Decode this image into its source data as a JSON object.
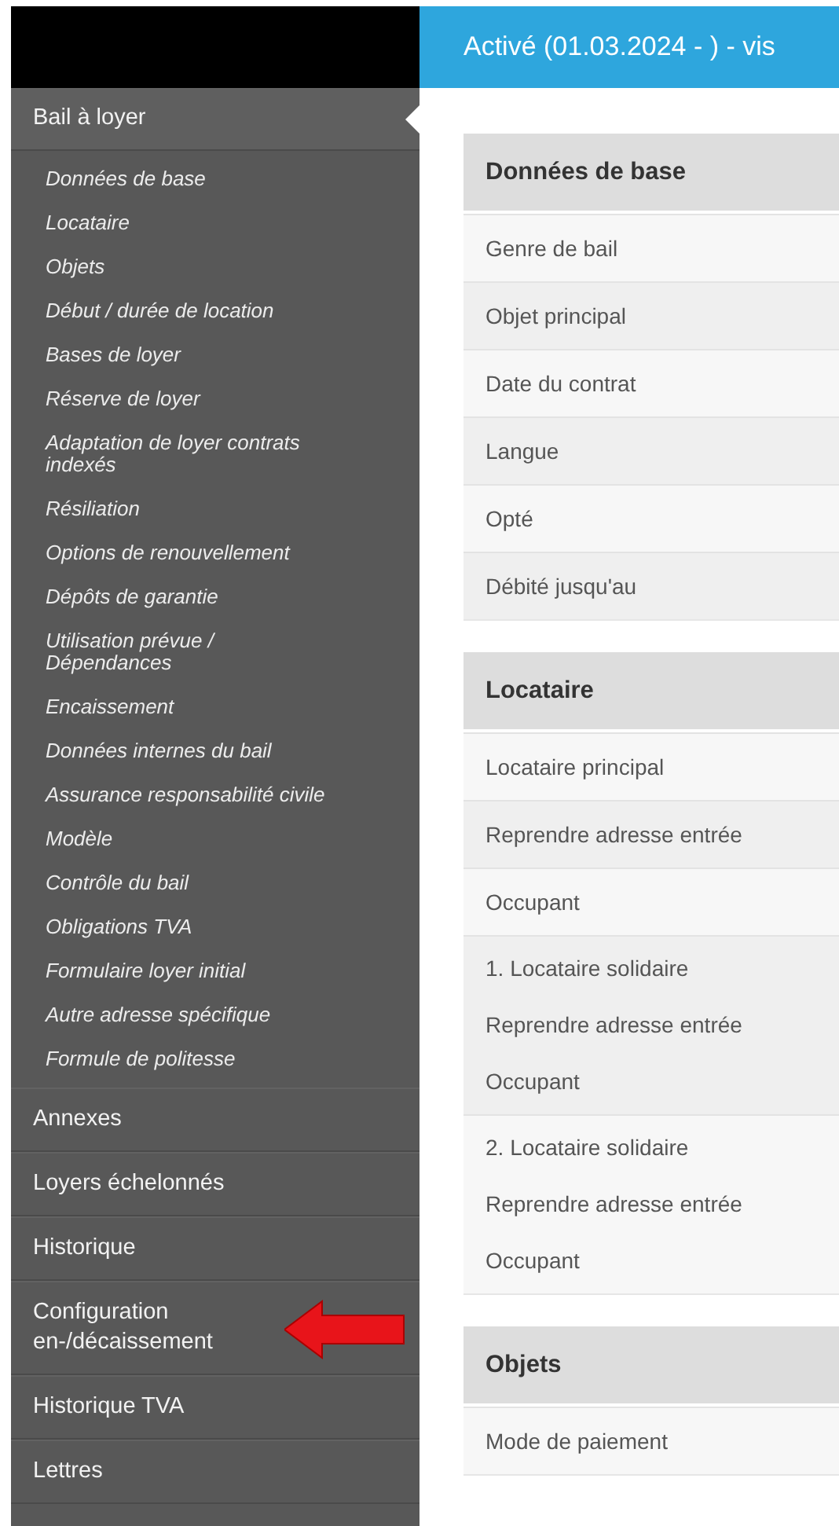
{
  "header": {
    "title": "Activé (01.03.2024 - ) - vis"
  },
  "sidebar": {
    "items": [
      {
        "label": "Bail à loyer",
        "selected": true,
        "annotated": false,
        "children": [
          {
            "label": "Données de base"
          },
          {
            "label": "Locataire"
          },
          {
            "label": "Objets"
          },
          {
            "label": "Début / durée de location"
          },
          {
            "label": "Bases de loyer"
          },
          {
            "label": "Réserve de loyer"
          },
          {
            "label": "Adaptation de loyer contrats indexés"
          },
          {
            "label": "Résiliation"
          },
          {
            "label": "Options de renouvellement"
          },
          {
            "label": "Dépôts de garantie"
          },
          {
            "label": "Utilisation prévue / Dépendances"
          },
          {
            "label": "Encaissement"
          },
          {
            "label": "Données internes du bail"
          },
          {
            "label": "Assurance responsabilité civile"
          },
          {
            "label": "Modèle"
          },
          {
            "label": "Contrôle du bail"
          },
          {
            "label": "Obligations TVA"
          },
          {
            "label": "Formulaire loyer initial"
          },
          {
            "label": "Autre adresse spécifique"
          },
          {
            "label": "Formule de politesse"
          }
        ]
      },
      {
        "label": "Annexes",
        "selected": false,
        "annotated": false
      },
      {
        "label": "Loyers échelonnés",
        "selected": false,
        "annotated": false
      },
      {
        "label": "Historique",
        "selected": false,
        "annotated": false
      },
      {
        "label": "Configuration en-/décaissement",
        "selected": false,
        "annotated": true
      },
      {
        "label": "Historique TVA",
        "selected": false,
        "annotated": false
      },
      {
        "label": "Lettres",
        "selected": false,
        "annotated": false
      }
    ]
  },
  "sections": [
    {
      "title": "Données de base",
      "rows": [
        {
          "lines": [
            "Genre de bail"
          ]
        },
        {
          "lines": [
            "Objet principal"
          ]
        },
        {
          "lines": [
            "Date du contrat"
          ]
        },
        {
          "lines": [
            "Langue"
          ]
        },
        {
          "lines": [
            "Opté"
          ]
        },
        {
          "lines": [
            "Débité jusqu'au"
          ]
        }
      ]
    },
    {
      "title": "Locataire",
      "rows": [
        {
          "lines": [
            "Locataire principal"
          ]
        },
        {
          "lines": [
            "Reprendre adresse entrée"
          ]
        },
        {
          "lines": [
            "Occupant"
          ]
        },
        {
          "lines": [
            "1. Locataire solidaire",
            "Reprendre adresse entrée",
            "Occupant"
          ]
        },
        {
          "lines": [
            "2. Locataire solidaire",
            "Reprendre adresse entrée",
            "Occupant"
          ]
        }
      ]
    },
    {
      "title": "Objets",
      "rows": [
        {
          "lines": [
            "Mode de paiement"
          ]
        }
      ]
    }
  ]
}
